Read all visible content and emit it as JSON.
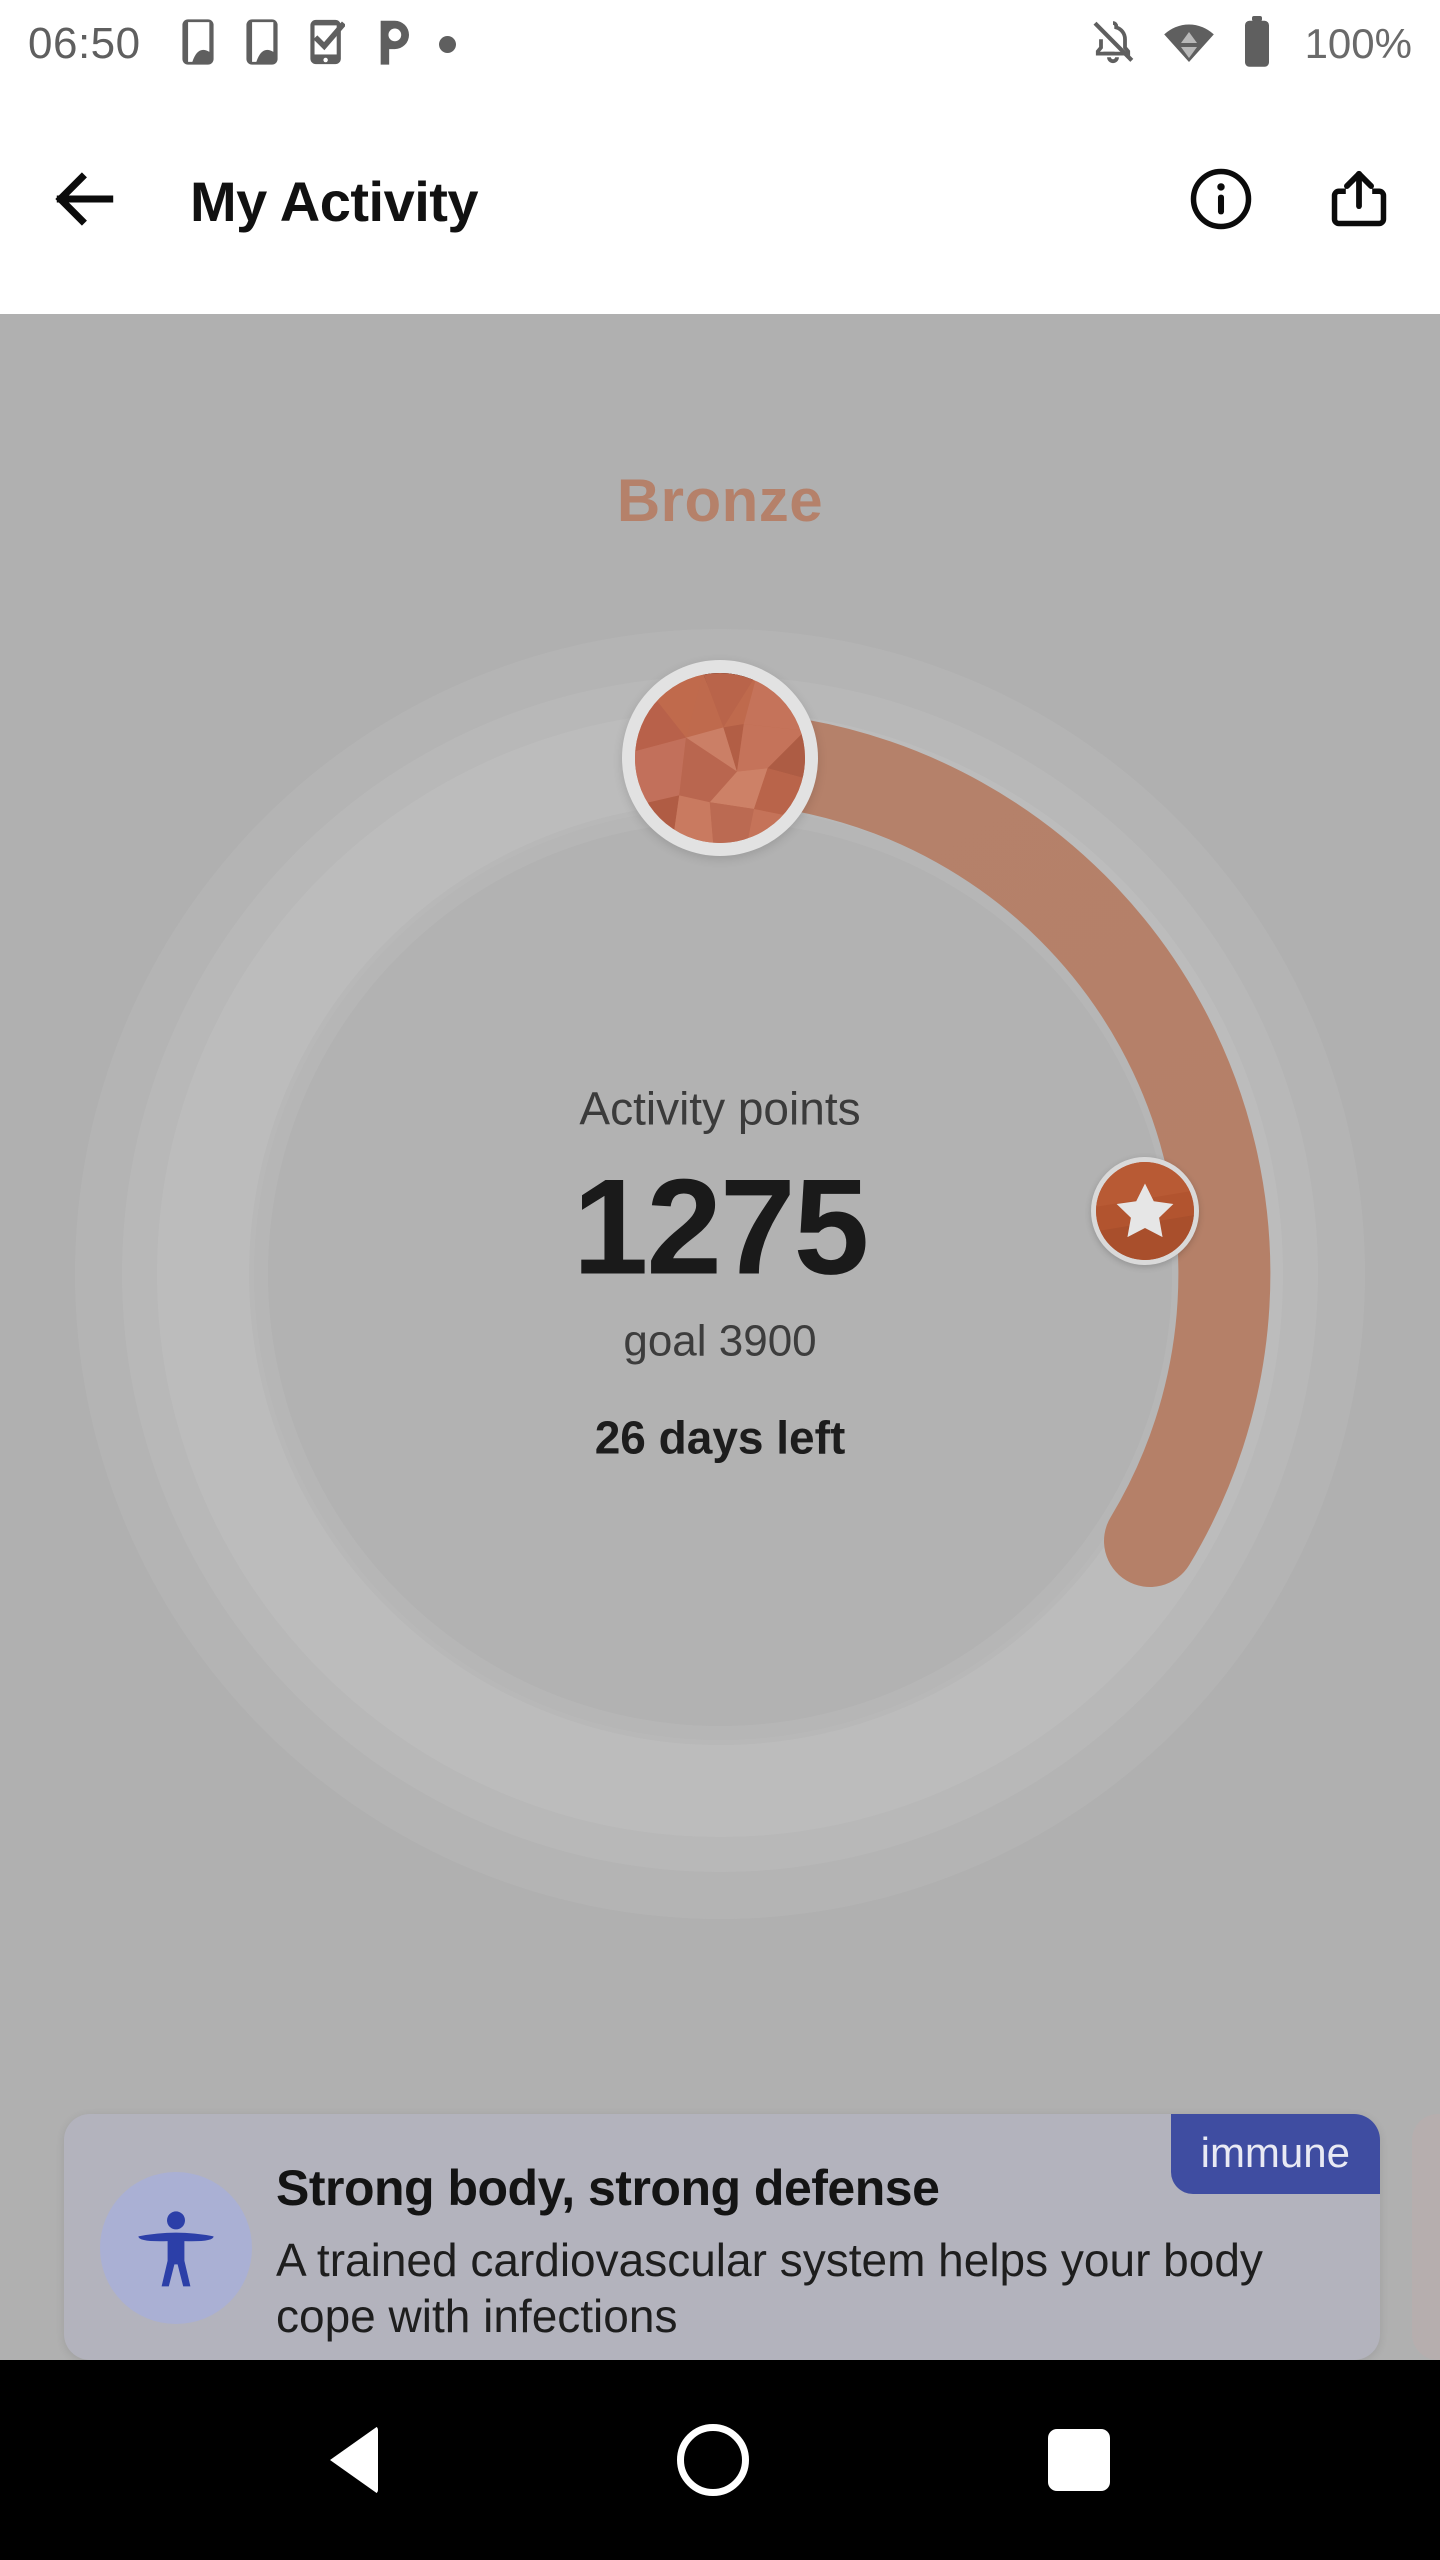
{
  "status_bar": {
    "time": "06:50",
    "battery_percent": "100%",
    "left_icons": [
      "sim-card-icon",
      "sim-card-icon",
      "phone-check-icon",
      "p-parking-icon",
      "dot-icon"
    ],
    "right_icons": [
      "notifications-off-icon",
      "wifi-icon",
      "battery-full-icon"
    ]
  },
  "app_bar": {
    "back_icon": "arrow-back-icon",
    "title": "My Activity",
    "info_icon": "info-circle-icon",
    "share_icon": "share-icon"
  },
  "activity": {
    "tier": "Bronze",
    "tier_color": "#b5816a",
    "points_label": "Activity points",
    "points_value": "1275",
    "goal_text": "goal 3900",
    "days_left": "26 days left",
    "medal_icon": "bronze-gem-medal-icon",
    "milestone_icon": "star-badge-icon",
    "progress_track_color": "#bcbcbc",
    "progress_fill_color": "#b5826a"
  },
  "chart_data": {
    "type": "gauge",
    "title": "Activity points",
    "value": 1275,
    "goal": 3900,
    "percent_complete": 32.7,
    "unit": "points",
    "tier": "Bronze",
    "days_remaining": 26,
    "track_color": "#bcbcbc",
    "fill_color": "#b5826a",
    "markers": [
      {
        "name": "bronze-medal",
        "position_percent": 0,
        "icon": "bronze-gem-medal-icon"
      },
      {
        "name": "next-milestone-star",
        "position_percent": 25,
        "icon": "star-badge-icon"
      }
    ]
  },
  "card": {
    "badge": "immune",
    "badge_color": "#3f4da1",
    "icon": "accessibility-person-icon",
    "title": "Strong body, strong defense",
    "text": "A trained cardiovascular system helps your body cope with infections"
  },
  "nav_bar": {
    "back": "nav-back-icon",
    "home": "nav-home-icon",
    "recents": "nav-recents-icon"
  }
}
